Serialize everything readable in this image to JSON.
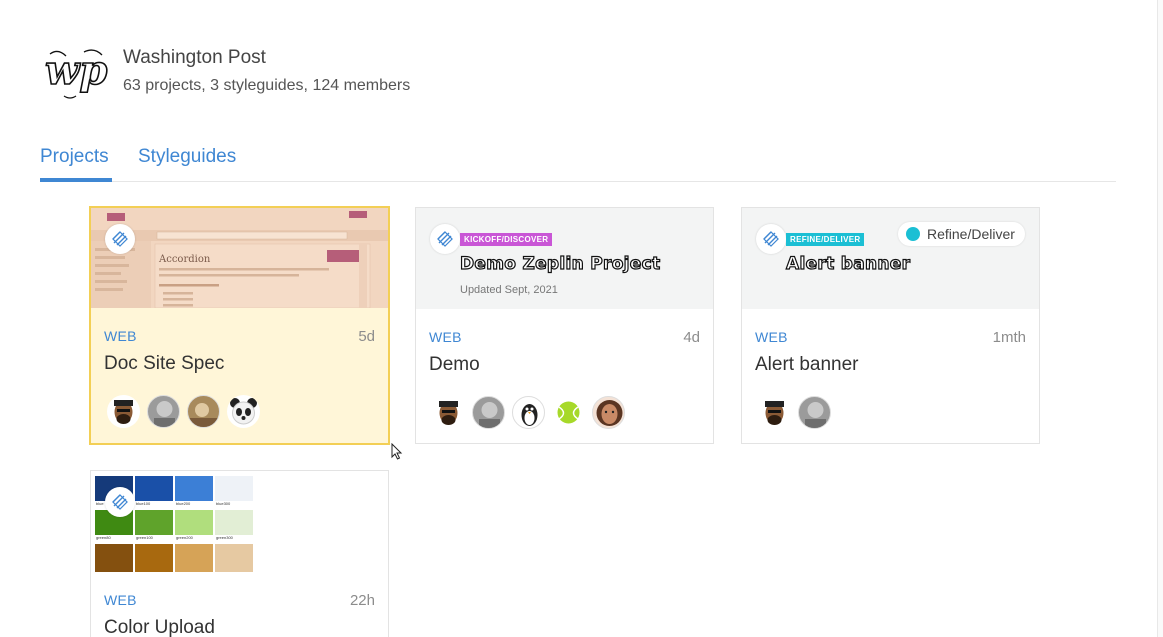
{
  "org": {
    "name": "Washington Post",
    "stats": "63 projects, 3 styleguides, 124 members",
    "logo_text": "wp"
  },
  "tabs": [
    {
      "label": "Projects",
      "active": true
    },
    {
      "label": "Styleguides",
      "active": false
    }
  ],
  "colors": {
    "accent": "#3f87d3",
    "selected_bg": "#fff6d8",
    "selected_border": "#f3cf55",
    "kickoff_tag": "#c956d6",
    "refine_tag": "#1bbfd4"
  },
  "projects": [
    {
      "platform": "WEB",
      "time": "5d",
      "title": "Doc Site Spec",
      "selected": true,
      "thumb": {
        "heading": "Accordion"
      },
      "avatars": [
        "man-beard-avatar",
        "gray-avatar",
        "photo-avatar",
        "panda-avatar"
      ]
    },
    {
      "platform": "WEB",
      "time": "4d",
      "title": "Demo",
      "thumb": {
        "tag": "KICKOFF/DISCOVER",
        "title": "Demo Zeplin Project",
        "subtitle": "Updated Sept, 2021"
      },
      "avatars": [
        "man-beard-avatar",
        "gray-avatar",
        "penguin-avatar",
        "tennis-ball-avatar",
        "woman-avatar"
      ]
    },
    {
      "platform": "WEB",
      "time": "1mth",
      "title": "Alert banner",
      "status": "Refine/Deliver",
      "thumb": {
        "tag": "REFINE/DELIVER",
        "title": "Alert banner"
      },
      "avatars": [
        "man-beard-avatar",
        "gray-avatar"
      ]
    },
    {
      "platform": "WEB",
      "time": "22h",
      "title": "Color Upload",
      "thumb": {
        "swatches": [
          {
            "label": "blue",
            "color": "#153a7a"
          },
          {
            "label": "blue100",
            "color": "#1a50a8"
          },
          {
            "label": "blue200",
            "color": "#3c7fd6"
          },
          {
            "label": "blue300",
            "color": "#eef2f7"
          },
          {
            "label": "green80",
            "color": "#3f8a12"
          },
          {
            "label": "green100",
            "color": "#5fa32b"
          },
          {
            "label": "green200",
            "color": "#b0de7d"
          },
          {
            "label": "green300",
            "color": "#e2eed5"
          },
          {
            "label": "",
            "color": "#84500f"
          },
          {
            "label": "",
            "color": "#a8690f"
          },
          {
            "label": "",
            "color": "#d6a357"
          },
          {
            "label": "",
            "color": "#e6c9a2"
          }
        ]
      },
      "avatars": []
    }
  ]
}
